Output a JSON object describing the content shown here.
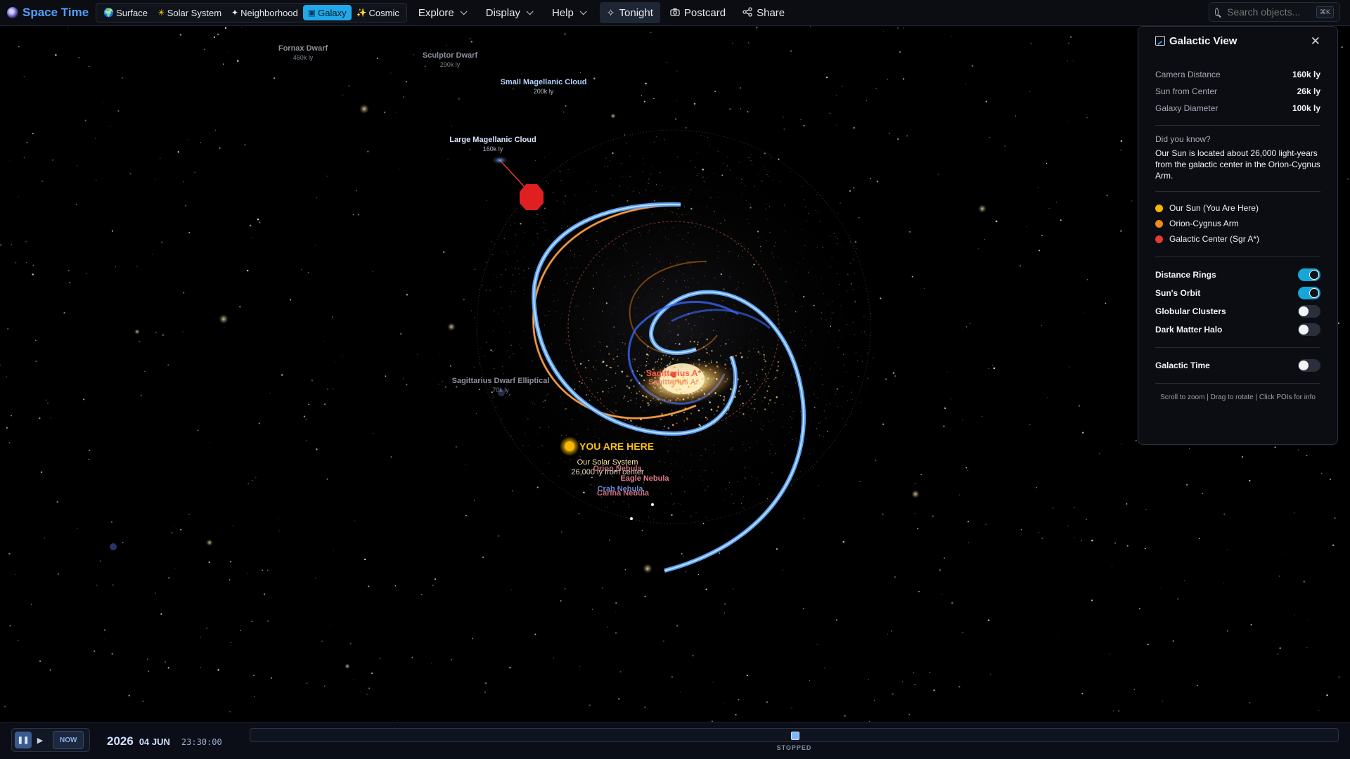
{
  "app": {
    "title": "Space Time"
  },
  "modes": [
    {
      "icon": "globe-icon",
      "glyph": "🌍",
      "label": "Surface",
      "active": false
    },
    {
      "icon": "sun-icon",
      "glyph": "☀",
      "label": "Solar System",
      "active": false
    },
    {
      "icon": "sparkle-icon",
      "glyph": "✦",
      "label": "Neighborhood",
      "active": false
    },
    {
      "icon": "galaxy-icon",
      "glyph": "▣",
      "label": "Galaxy",
      "active": true
    },
    {
      "icon": "cosmic-icon",
      "glyph": "✨",
      "label": "Cosmic",
      "active": false
    }
  ],
  "menus": {
    "explore": "Explore",
    "display": "Display",
    "help": "Help"
  },
  "tools": {
    "tonight": "Tonight",
    "postcard": "Postcard",
    "share": "Share"
  },
  "search": {
    "placeholder": "Search objects...",
    "shortcut": "⌘K"
  },
  "scene": {
    "pois": {
      "fornax": {
        "name": "Fornax Dwarf",
        "distance": "460k ly"
      },
      "sculptor": {
        "name": "Sculptor Dwarf",
        "distance": "290k ly"
      },
      "smc": {
        "name": "Small Magellanic Cloud",
        "distance": "200k ly"
      },
      "lmc": {
        "name": "Large Magellanic Cloud",
        "distance": "160k ly"
      },
      "sagittarius_dwarf": {
        "name": "Sagittarius Dwarf Elliptical",
        "distance": "70k ly"
      },
      "sgr_a": {
        "name": "Sagittarius A*"
      }
    },
    "you_are_here": "YOU ARE HERE",
    "solar_system": {
      "name": "Our Solar System",
      "distance": "26,000 ly from center"
    },
    "nebulae": {
      "orion": "Orion Nebula",
      "eagle": "Eagle Nebula",
      "crab": "Crab Nebula",
      "carina": "Carina Nebula"
    }
  },
  "panel": {
    "title": "Galactic View",
    "stats": [
      {
        "label": "Camera Distance",
        "value": "160k ly"
      },
      {
        "label": "Sun from Center",
        "value": "26k ly"
      },
      {
        "label": "Galaxy Diameter",
        "value": "100k ly"
      }
    ],
    "did_you_know": {
      "title": "Did you know?",
      "text": "Our Sun is located about 26,000 light-years from the galactic center in the Orion-Cygnus Arm."
    },
    "legend": [
      {
        "label": "Our Sun (You Are Here)",
        "color": "#f5b800"
      },
      {
        "label": "Orion-Cygnus Arm",
        "color": "#f08a1c"
      },
      {
        "label": "Galactic Center (Sgr A*)",
        "color": "#e53a35"
      }
    ],
    "toggles": [
      {
        "label": "Distance Rings",
        "on": true
      },
      {
        "label": "Sun's Orbit",
        "on": true
      },
      {
        "label": "Globular Clusters",
        "on": false
      },
      {
        "label": "Dark Matter Halo",
        "on": false
      }
    ],
    "galactic_time": {
      "label": "Galactic Time",
      "on": false
    },
    "footer": "Scroll to zoom | Drag to rotate | Click POIs for info"
  },
  "timeline": {
    "now_label": "NOW",
    "year": "2026",
    "day": "04 JUN",
    "time": "23:30:00",
    "speed_label": "STOPPED",
    "position": 0.5
  },
  "colors": {
    "accent": "#21a8e8",
    "brand": "#4fa0ff",
    "arm_blue": "#5aa8ff",
    "arm_orange": "#f08a1c",
    "sun": "#f5b800",
    "galactic_center": "#e53a35"
  }
}
